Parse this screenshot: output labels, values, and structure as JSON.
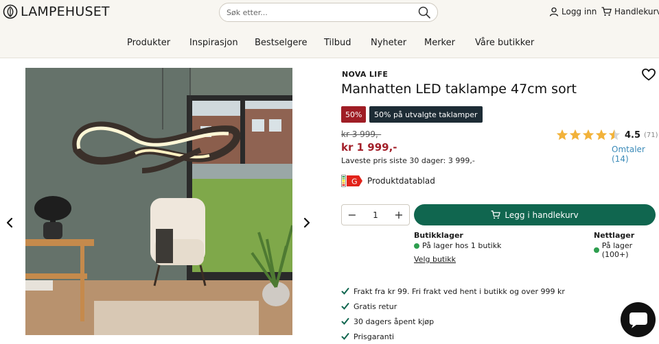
{
  "header": {
    "logo_text": "LAMPEHUSET",
    "search_placeholder": "Søk etter...",
    "login_label": "Logg inn",
    "cart_label": "Handlekurv"
  },
  "nav": [
    "Produkter",
    "Inspirasjon",
    "Bestselgere",
    "Tilbud",
    "Nyheter",
    "Merker",
    "Våre butikker"
  ],
  "product": {
    "brand": "NOVA LIFE",
    "title": "Manhatten LED taklampe 47cm sort",
    "discount_badge": "50%",
    "campaign_badge": "50% på utvalgte taklamper",
    "old_price": "kr 3 999,-",
    "new_price": "kr 1 999,-",
    "lowest_price_text": "Laveste pris siste 30 dager: 3 999,-",
    "rating": "4.5",
    "rating_value": 4.5,
    "rating_count": "(71)",
    "reviews_link": "Omtaler (14)",
    "energy_class": "G",
    "datasheet_label": "Produktdatablad",
    "quantity": "1",
    "add_to_cart_label": "Legg i handlekurv"
  },
  "stock": {
    "store_title": "Butikklager",
    "store_status": "På lager hos 1 butikk",
    "online_title": "Nettlager",
    "online_status": "På lager (100+)",
    "choose_store": "Velg butikk"
  },
  "usps": [
    "Frakt fra kr 99. Fri frakt ved hent i butikk og over 999 kr",
    "Gratis retur",
    "30 dagers åpent kjøp",
    "Prisgaranti"
  ],
  "colors": {
    "accent_green": "#10664f",
    "price_red": "#a3202a",
    "badge_dark": "#1d2c35",
    "star": "#f2b23a",
    "link_blue": "#3a8ab8"
  }
}
